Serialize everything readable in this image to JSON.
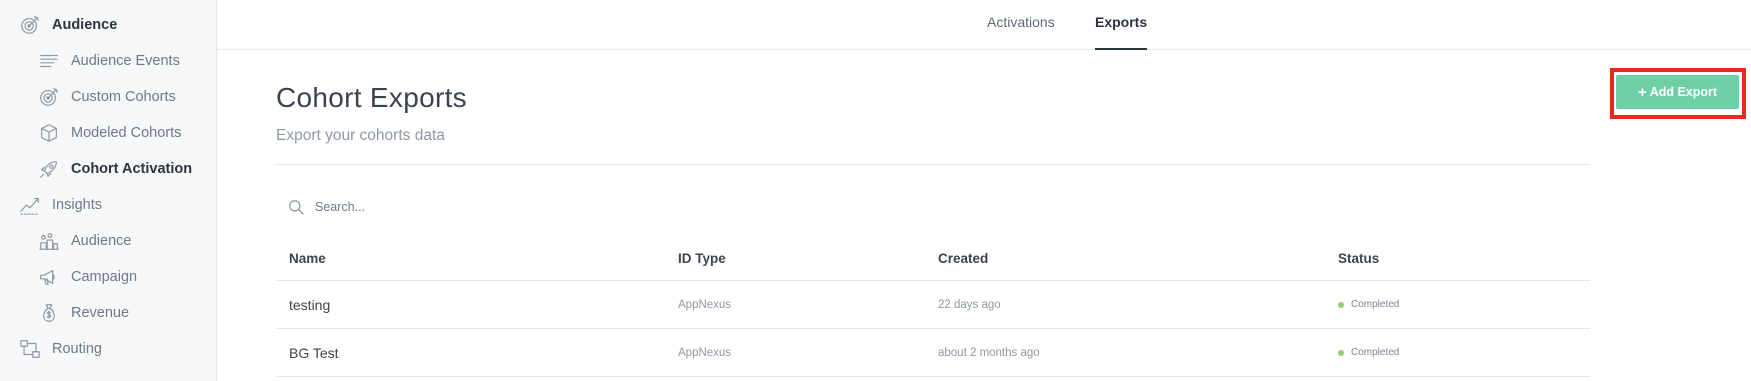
{
  "sidebar": {
    "items": [
      {
        "label": "Audience",
        "icon": "target-icon",
        "level": "top",
        "active": true
      },
      {
        "label": "Audience Events",
        "icon": "lines-icon",
        "level": "sub"
      },
      {
        "label": "Custom Cohorts",
        "icon": "target-icon",
        "level": "sub"
      },
      {
        "label": "Modeled Cohorts",
        "icon": "cube-icon",
        "level": "sub"
      },
      {
        "label": "Cohort Activation",
        "icon": "rocket-icon",
        "level": "sub",
        "active": true
      },
      {
        "label": "Insights",
        "icon": "trend-icon",
        "level": "top"
      },
      {
        "label": "Audience",
        "icon": "people-chart-icon",
        "level": "sub"
      },
      {
        "label": "Campaign",
        "icon": "megaphone-icon",
        "level": "sub"
      },
      {
        "label": "Revenue",
        "icon": "money-bag-icon",
        "level": "sub"
      },
      {
        "label": "Routing",
        "icon": "routing-icon",
        "level": "top"
      }
    ]
  },
  "tabs": [
    {
      "label": "Activations",
      "active": false
    },
    {
      "label": "Exports",
      "active": true
    }
  ],
  "header": {
    "title": "Cohort Exports",
    "subtitle": "Export your cohorts data"
  },
  "add_button": {
    "plus": "+",
    "label": "Add Export"
  },
  "search": {
    "placeholder": "Search...",
    "value": ""
  },
  "table": {
    "columns": [
      "Name",
      "ID Type",
      "Created",
      "Status"
    ],
    "rows": [
      {
        "name": "testing",
        "id_type": "AppNexus",
        "created": "22 days ago",
        "status": "Completed"
      },
      {
        "name": "BG Test",
        "id_type": "AppNexus",
        "created": "about 2 months ago",
        "status": "Completed"
      }
    ]
  },
  "colors": {
    "accent": "#6fcfa7",
    "highlight_frame": "#e8291c",
    "status_completed": "#8fcf6f",
    "sidebar_bg": "#f7f8f9"
  }
}
